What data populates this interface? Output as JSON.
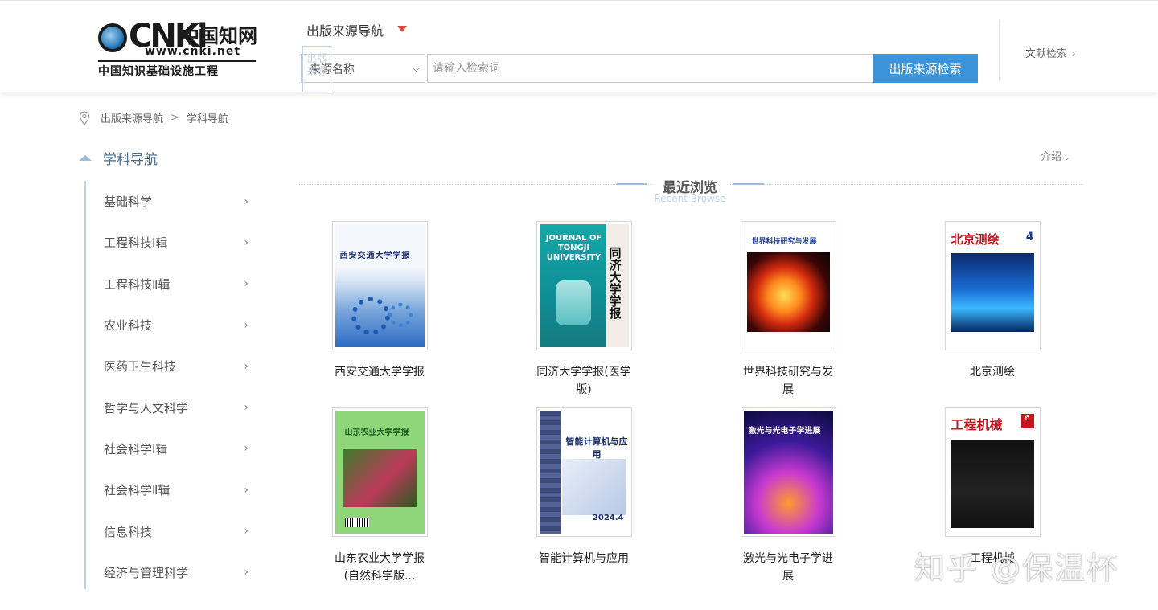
{
  "header": {
    "logo": {
      "wordmark": "CNKi",
      "cn_name": "中国知网",
      "url": "www.cnki.net",
      "tagline": "中国知识基础设施工程"
    },
    "nav_title": "出版来源导航",
    "search": {
      "field_select": "来源名称",
      "ghost_text": "出版来源",
      "placeholder": "请输入检索词",
      "button_label": "出版来源检索"
    },
    "lit_search_link": "文献检索"
  },
  "breadcrumb": [
    "出版来源导航",
    ">",
    "学科导航"
  ],
  "sidebar": {
    "title": "学科导航",
    "items": [
      {
        "label": "基础科学"
      },
      {
        "label": "工程科技Ⅰ辑"
      },
      {
        "label": "工程科技Ⅱ辑"
      },
      {
        "label": "农业科技"
      },
      {
        "label": "医药卫生科技"
      },
      {
        "label": "哲学与人文科学"
      },
      {
        "label": "社会科学Ⅰ辑"
      },
      {
        "label": "社会科学Ⅱ辑"
      },
      {
        "label": "信息科技"
      },
      {
        "label": "经济与管理科学"
      }
    ]
  },
  "intro_link": "介绍",
  "recent": {
    "title": "最近浏览",
    "subtitle": "Recent Browse",
    "items": [
      {
        "name": "西安交通大学学报",
        "cover_title": "西安交通大学学报"
      },
      {
        "name": "同济大学学报(医学版)",
        "cover_title": "同济大学学报",
        "cover_sub": "JOURNAL OF TONGJI UNIVERSITY"
      },
      {
        "name": "世界科技研究与发展",
        "cover_title": "世界科技研究与发展"
      },
      {
        "name": "北京测绘",
        "cover_title": "北京测绘",
        "cover_num": "4"
      },
      {
        "name": "山东农业大学学报(自然科学版...",
        "cover_title": "山东农业大学学报"
      },
      {
        "name": "智能计算机与应用",
        "cover_title": "智能计算机与应用",
        "cover_year": "2024.4"
      },
      {
        "name": "激光与光电子学进展",
        "cover_title": "激光与光电子学进展"
      },
      {
        "name": "工程机械",
        "cover_title": "工程机械",
        "cover_num": "6"
      }
    ]
  },
  "watermark": "知乎 @保温杯",
  "colors": {
    "accent_blue": "#3b94d9",
    "caret_red": "#e0463b",
    "sidebar_line": "#b9d3ee"
  }
}
